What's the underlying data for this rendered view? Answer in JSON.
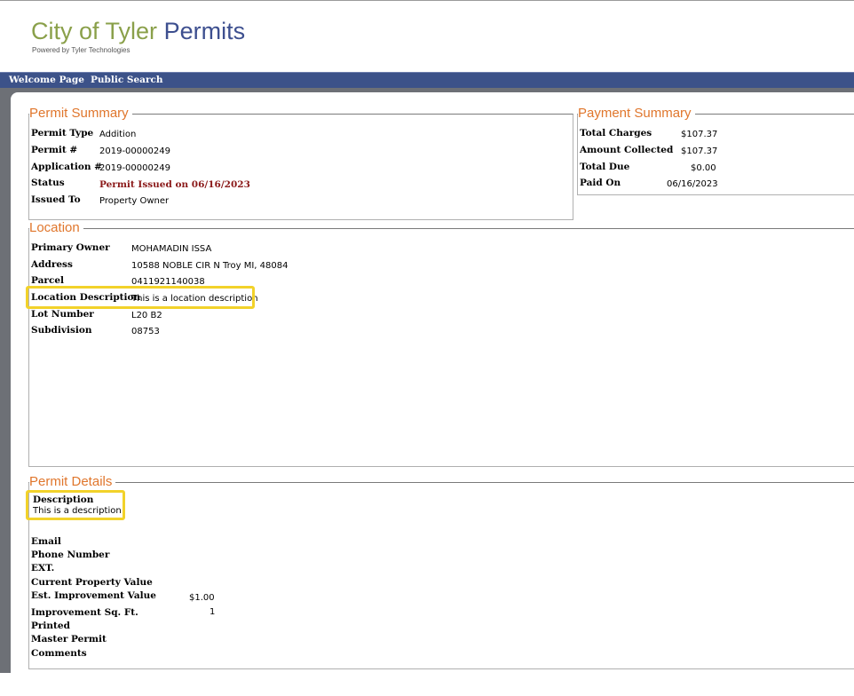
{
  "header": {
    "brand_city": "City of Tyler",
    "brand_permits": "Permits",
    "powered_by": "Powered by Tyler Technologies"
  },
  "nav": {
    "items": [
      "Welcome Page",
      "Public Search"
    ]
  },
  "permit_summary": {
    "title": "Permit Summary",
    "rows": [
      {
        "label": "Permit Type",
        "value": "Addition"
      },
      {
        "label": "Permit #",
        "value": "2019-00000249"
      },
      {
        "label": "Application #",
        "value": "2019-00000249"
      },
      {
        "label": "Status",
        "value": "Permit Issued on 06/16/2023"
      },
      {
        "label": "Issued To",
        "value": "Property Owner"
      }
    ]
  },
  "payment_summary": {
    "title": "Payment Summary",
    "rows": [
      {
        "label": "Total Charges",
        "value": "$107.37"
      },
      {
        "label": "Amount Collected",
        "value": "$107.37"
      },
      {
        "label": "Total Due",
        "value": "$0.00"
      },
      {
        "label": "Paid On",
        "value": "06/16/2023"
      }
    ]
  },
  "location": {
    "title": "Location",
    "rows": [
      {
        "label": "Primary Owner",
        "value": "MOHAMADIN ISSA"
      },
      {
        "label": "Address",
        "value": "10588 NOBLE CIR N Troy MI, 48084"
      },
      {
        "label": "Parcel",
        "value": "0411921140038"
      },
      {
        "label": "Location Description",
        "value": "This is a location description"
      },
      {
        "label": "Lot Number",
        "value": "L20 B2"
      },
      {
        "label": "Subdivision",
        "value": "08753"
      }
    ]
  },
  "permit_details": {
    "title": "Permit Details",
    "description_label": "Description",
    "description_value": "This is a description",
    "rows": [
      {
        "label": "Email",
        "value": ""
      },
      {
        "label": "Phone Number",
        "value": ""
      },
      {
        "label": "EXT.",
        "value": ""
      },
      {
        "label": "Current Property Value",
        "value": ""
      },
      {
        "label": "Est. Improvement Value",
        "value": "$1.00"
      },
      {
        "label": "Improvement Sq. Ft.",
        "value": "1"
      },
      {
        "label": "Printed",
        "value": ""
      },
      {
        "label": "Master Permit",
        "value": ""
      },
      {
        "label": "Comments",
        "value": ""
      }
    ]
  },
  "colors": {
    "nav_bg": "#3c5289",
    "legend": "#e0762c",
    "brand_city": "#8aa04a",
    "brand_permits": "#3d4f8f",
    "status_red": "#8b1a1a",
    "highlight": "#f2d22a"
  }
}
